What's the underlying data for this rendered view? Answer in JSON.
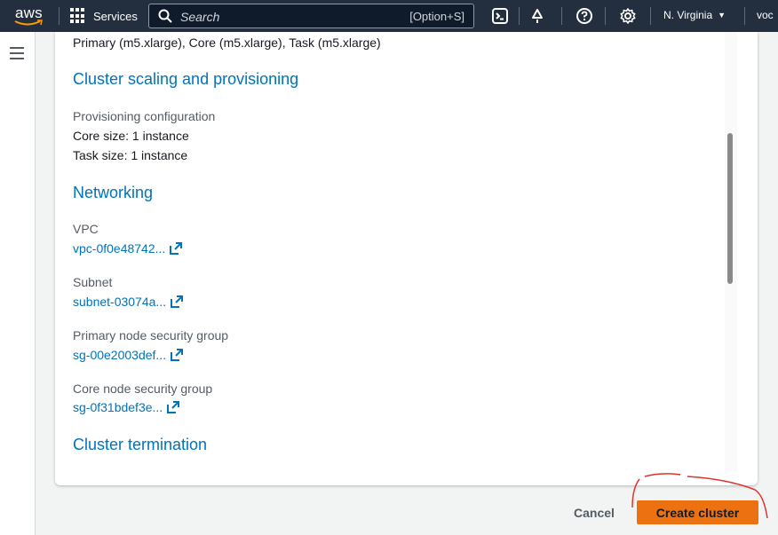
{
  "nav": {
    "logo": "aws",
    "services_label": "Services",
    "search_placeholder": "Search",
    "search_shortcut": "[Option+S]",
    "region": "N. Virginia",
    "account": "voc"
  },
  "content": {
    "previous_line": "Primary (m5.xlarge), Core (m5.xlarge), Task (m5.xlarge)",
    "scaling": {
      "heading": "Cluster scaling and provisioning",
      "provisioning_label": "Provisioning configuration",
      "core_size": "Core size: 1 instance",
      "task_size": "Task size: 1 instance"
    },
    "networking": {
      "heading": "Networking",
      "vpc_label": "VPC",
      "vpc_value": "vpc-0f0e48742...",
      "subnet_label": "Subnet",
      "subnet_value": "subnet-03074a...",
      "primary_sg_label": "Primary node security group",
      "primary_sg_value": "sg-00e2003def...",
      "core_sg_label": "Core node security group",
      "core_sg_value": "sg-0f31bdef3e..."
    },
    "termination": {
      "heading": "Cluster termination"
    }
  },
  "actions": {
    "cancel_label": "Cancel",
    "create_label": "Create cluster"
  },
  "colors": {
    "nav_bg": "#232f3e",
    "link": "#0073bb",
    "primary_button": "#ec7211",
    "annotation": "#e0322b"
  }
}
